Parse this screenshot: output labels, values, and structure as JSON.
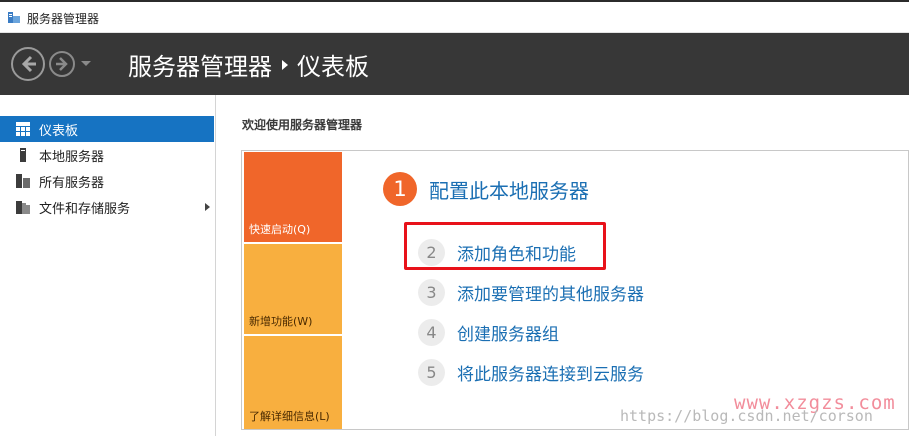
{
  "window": {
    "title": "服务器管理器"
  },
  "header": {
    "breadcrumb": [
      "服务器管理器",
      "仪表板"
    ]
  },
  "sidebar": {
    "items": [
      {
        "label": "仪表板",
        "icon": "dashboard-icon",
        "active": true
      },
      {
        "label": "本地服务器",
        "icon": "local-server-icon"
      },
      {
        "label": "所有服务器",
        "icon": "all-servers-icon"
      },
      {
        "label": "文件和存储服务",
        "icon": "file-storage-icon",
        "has_submenu": true
      }
    ]
  },
  "main": {
    "welcome": "欢迎使用服务器管理器",
    "tiles": [
      "快速启动(Q)",
      "新增功能(W)",
      "了解详细信息(L)"
    ],
    "step1": {
      "number": "1",
      "label": "配置此本地服务器"
    },
    "steps": [
      {
        "number": "2",
        "label": "添加角色和功能"
      },
      {
        "number": "3",
        "label": "添加要管理的其他服务器"
      },
      {
        "number": "4",
        "label": "创建服务器组"
      },
      {
        "number": "5",
        "label": "将此服务器连接到云服务"
      }
    ]
  },
  "watermarks": {
    "site": "www.xzgzs.com",
    "blog": "https://blog.csdn.net/corson"
  },
  "colors": {
    "accent_blue": "#1673c2",
    "link_blue": "#1b6fb3",
    "orange": "#f0662a",
    "light_orange": "#f8af3f",
    "highlight_red": "#e8121a",
    "header_bg": "#373737"
  }
}
